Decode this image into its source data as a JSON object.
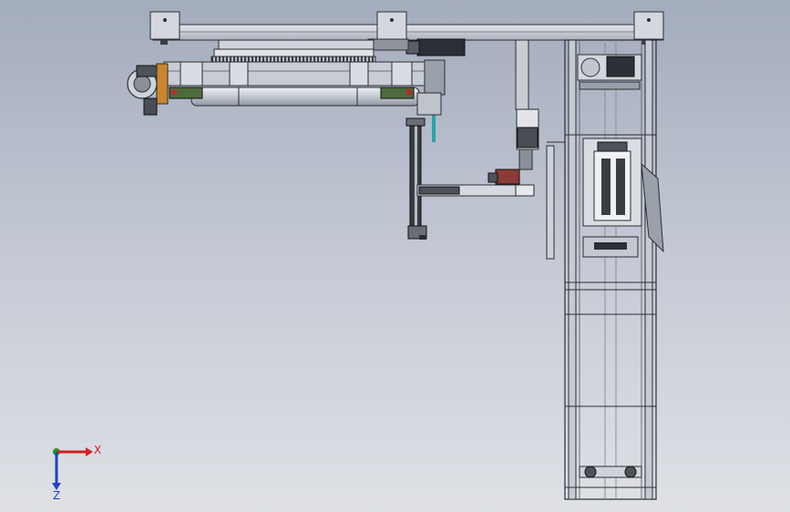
{
  "triad": {
    "x_label": "X",
    "z_label": "Z",
    "colors": {
      "x": "#d42020",
      "y": "#1fa01f",
      "z": "#2040c8"
    }
  },
  "model": {
    "colors": {
      "steel_light": "#d6dae2",
      "steel_mid": "#aeb4c0",
      "steel_dark": "#4a4d55",
      "outline": "#2b2d33",
      "accent_red": "#b0302a",
      "accent_cyan": "#2aa3a8",
      "accent_orange": "#c9862d"
    }
  }
}
